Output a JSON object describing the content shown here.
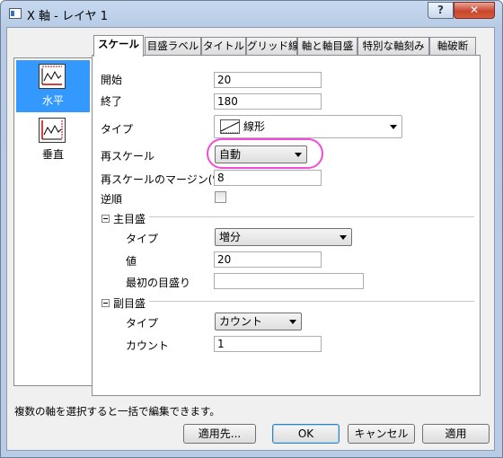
{
  "window": {
    "title": "X 軸 - レイヤ 1",
    "help_label": "?",
    "close_label": "✕"
  },
  "sidebar": {
    "items": [
      {
        "label": "水平",
        "icon": "horizontal-axis-icon",
        "selected": true
      },
      {
        "label": "垂直",
        "icon": "vertical-axis-icon",
        "selected": false
      }
    ]
  },
  "tabs": [
    {
      "label": "スケール",
      "active": true
    },
    {
      "label": "目盛ラベル"
    },
    {
      "label": "タイトル"
    },
    {
      "label": "グリッド線"
    },
    {
      "label": "軸と軸目盛"
    },
    {
      "label": "特別な軸刻み"
    },
    {
      "label": "軸破断"
    }
  ],
  "scale": {
    "start_label": "開始",
    "start_value": "20",
    "end_label": "終了",
    "end_value": "180",
    "type_label": "タイプ",
    "type_value": "線形",
    "rescale_label": "再スケール",
    "rescale_value": "自動",
    "margin_label": "再スケールのマージン(%)",
    "margin_value": "8",
    "reverse_label": "逆順"
  },
  "major": {
    "group_label": "主目盛",
    "type_label": "タイプ",
    "type_value": "増分",
    "value_label": "値",
    "value": "20",
    "first_label": "最初の目盛り",
    "first_value": ""
  },
  "minor": {
    "group_label": "副目盛",
    "type_label": "タイプ",
    "type_value": "カウント",
    "count_label": "カウント",
    "count_value": "1"
  },
  "status_text": "複数の軸を選択すると一括で編集できます。",
  "buttons": {
    "apply_to": "適用先...",
    "ok": "OK",
    "cancel": "キャンセル",
    "apply": "適用"
  },
  "colors": {
    "selection": "#3399ff",
    "highlight_ring": "#f04cd8"
  }
}
